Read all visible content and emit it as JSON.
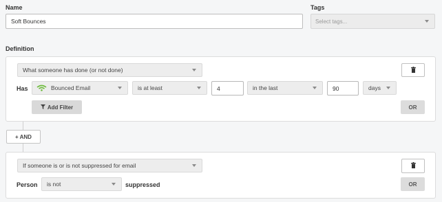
{
  "name": {
    "label": "Name",
    "value": "Soft Bounces"
  },
  "tags": {
    "label": "Tags",
    "placeholder": "Select tags..."
  },
  "definition": {
    "label": "Definition"
  },
  "condition1": {
    "type_select": "What someone has done (or not done)",
    "has_label": "Has",
    "metric": "Bounced Email",
    "operator": "is at least",
    "count": "4",
    "timeframe": "in the last",
    "period_value": "90",
    "period_unit": "days",
    "add_filter_label": "Add Filter",
    "or_label": "OR",
    "metric_icon": "wifi-signal-icon"
  },
  "and_button": {
    "label": "+ AND"
  },
  "condition2": {
    "type_select": "If someone is or is not suppressed for email",
    "person_label": "Person",
    "operator": "is not",
    "suffix": "suppressed",
    "or_label": "OR"
  },
  "colors": {
    "metric_icon": "#6dbb3c",
    "accent": "#333333"
  }
}
